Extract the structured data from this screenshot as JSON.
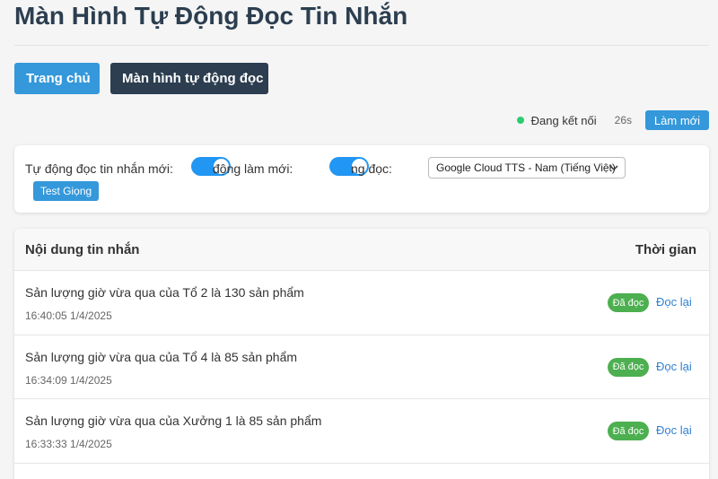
{
  "header": {
    "title": "Màn Hình Tự Động Đọc Tin Nhắn"
  },
  "nav": {
    "home_label": "Trang chủ",
    "auto_label": "Màn hình tự động đọc"
  },
  "status": {
    "text": "Đang kết nối",
    "countdown": "26s",
    "refresh_label": "Làm mới",
    "dot_color": "#2ecc71"
  },
  "settings": {
    "auto_read_label": "Tự động đọc tin nhắn mới:",
    "auto_read_on": true,
    "auto_refresh_label": "động làm mới:",
    "auto_refresh_on": true,
    "voice_label": "ng đọc:",
    "voice_selected": "Google Cloud TTS - Nam (Tiếng Việt)",
    "test_label": "Test Giọng"
  },
  "table": {
    "col_content": "Nội dung tin nhắn",
    "col_time": "Thời gian",
    "rows": [
      {
        "text": "Sản lượng giờ vừa qua của Tổ 2 là 130 sản phẩm",
        "time": "16:40:05 1/4/2025",
        "status": "Đã đọc",
        "action": "Đọc lại"
      },
      {
        "text": "Sản lượng giờ vừa qua của Tổ 4 là 85 sản phẩm",
        "time": "16:34:09 1/4/2025",
        "status": "Đã đọc",
        "action": "Đọc lại"
      },
      {
        "text": "Sản lượng giờ vừa qua của Xưởng 1 là 85 sản phẩm",
        "time": "16:33:33 1/4/2025",
        "status": "Đã đọc",
        "action": "Đọc lại"
      }
    ]
  },
  "colors": {
    "primary": "#3498db",
    "dark": "#2c3e50",
    "toggle_on": "#2196f3",
    "badge": "#4caf50",
    "link": "#2f80d1"
  }
}
